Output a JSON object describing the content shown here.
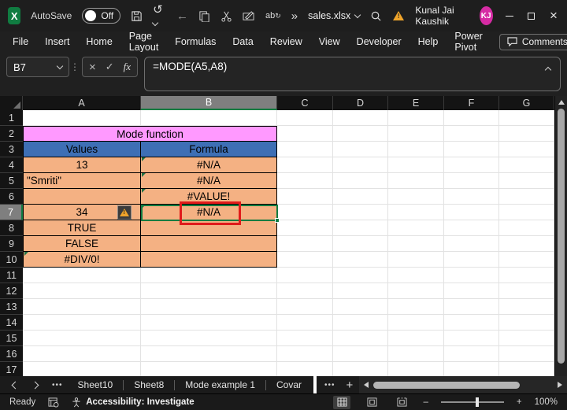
{
  "colors": {
    "titlebar_bg": "#1e1e1e",
    "panel_bg": "#202020",
    "grid_header_bg": "#141414",
    "grid_header_selected": "#7f7f7f",
    "cell_orange": "#F4B183",
    "header_pink": "#FF99FF",
    "header_blue": "#3E6FB5",
    "selection_green": "#107C41",
    "annotation_red": "#E01B1B",
    "excel_green": "#107C41",
    "share_green": "#23A455",
    "avatar_magenta": "#D62BA4",
    "warning_orange": "#EFA42B",
    "gridline": "#e2e2e2"
  },
  "icons": {
    "logo_letter": "X",
    "undo": "↺",
    "back_arrow": "←",
    "overflow": "»",
    "translate": "ab",
    "translate_arrow": "↻",
    "dots_v": "⋮",
    "dots_h": "•••",
    "cancel": "×",
    "confirm": "✓",
    "close": "×",
    "plus": "+",
    "minus": "–",
    "warning_mark": "!"
  },
  "titlebar": {
    "autosave_label": "AutoSave",
    "autosave_state": "Off",
    "filename": "sales.xlsx",
    "user_name": "Kunal Jai Kaushik",
    "user_initials": "KJ"
  },
  "menubar": {
    "tabs": [
      "File",
      "Insert",
      "Home",
      "Page Layout",
      "Formulas",
      "Data",
      "Review",
      "View",
      "Developer",
      "Help",
      "Power Pivot"
    ],
    "comments_label": "Comments"
  },
  "formula_bar": {
    "name_box": "B7",
    "fx_label": "fx",
    "formula": "=MODE(A5,A8)"
  },
  "grid": {
    "col_headers": [
      "A",
      "B",
      "C",
      "D",
      "E",
      "F",
      "G"
    ],
    "selected_cell": "B7",
    "rows": [
      {
        "n": "1",
        "a": "",
        "b": ""
      },
      {
        "n": "2",
        "merged": "Mode function"
      },
      {
        "n": "3",
        "a": "Values",
        "b": "Formula"
      },
      {
        "n": "4",
        "a": "13",
        "b": "#N/A"
      },
      {
        "n": "5",
        "a": "\"Smriti\"",
        "b": "#N/A"
      },
      {
        "n": "6",
        "a": "",
        "b": "#VALUE!"
      },
      {
        "n": "7",
        "a": "34",
        "b": "#N/A"
      },
      {
        "n": "8",
        "a": "TRUE",
        "b": ""
      },
      {
        "n": "9",
        "a": "FALSE",
        "b": ""
      },
      {
        "n": "10",
        "a": "#DIV/0!",
        "b": ""
      },
      {
        "n": "11",
        "a": "",
        "b": ""
      },
      {
        "n": "12",
        "a": "",
        "b": ""
      },
      {
        "n": "13",
        "a": "",
        "b": ""
      },
      {
        "n": "14",
        "a": "",
        "b": ""
      },
      {
        "n": "15",
        "a": "",
        "b": ""
      },
      {
        "n": "16",
        "a": "",
        "b": ""
      },
      {
        "n": "17",
        "a": "",
        "b": ""
      }
    ]
  },
  "sheet_tabs": {
    "tabs": [
      "Sheet10",
      "Sheet8",
      "Mode example 1",
      "Covar"
    ]
  },
  "status_bar": {
    "status": "Ready",
    "accessibility": "Accessibility: Investigate",
    "zoom": "100%"
  }
}
